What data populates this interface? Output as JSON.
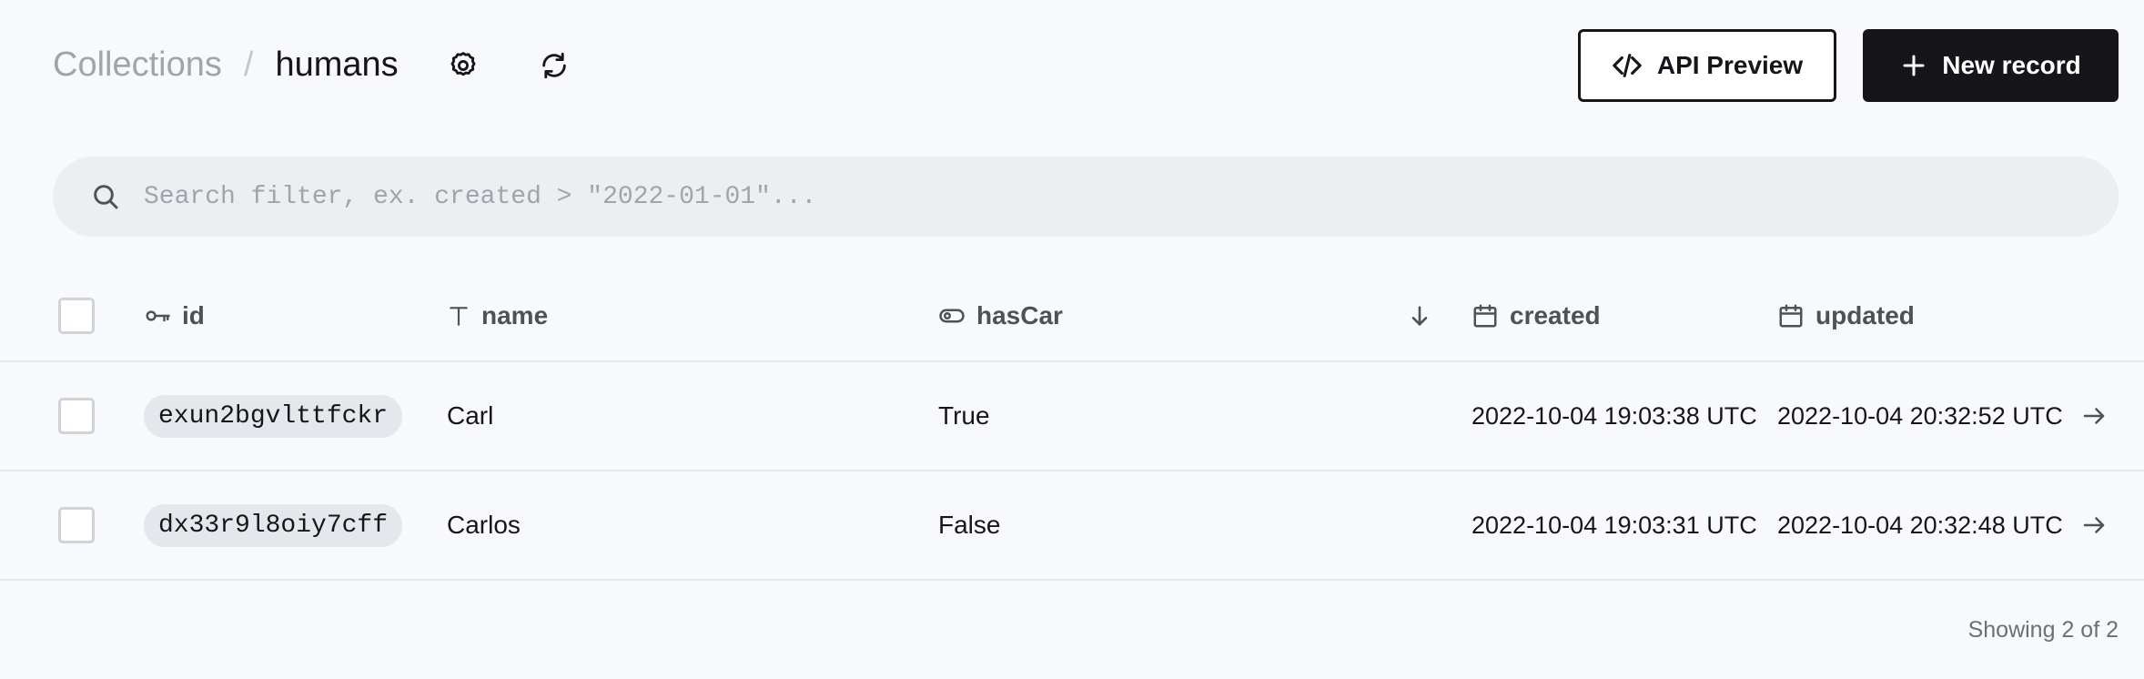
{
  "breadcrumb": {
    "parent": "Collections",
    "separator": "/",
    "current": "humans"
  },
  "toolbar": {
    "api_preview_label": "API Preview",
    "new_record_label": "New record"
  },
  "search": {
    "placeholder": "Search filter, ex. created > \"2022-01-01\"...",
    "value": ""
  },
  "table": {
    "columns": [
      {
        "label": "id",
        "icon": "key-icon"
      },
      {
        "label": "name",
        "icon": "text-icon"
      },
      {
        "label": "hasCar",
        "icon": "toggle-icon"
      },
      {
        "label": "created",
        "icon": "calendar-icon"
      },
      {
        "label": "updated",
        "icon": "calendar-icon"
      }
    ],
    "rows": [
      {
        "id": "exun2bgvlttfckr",
        "name": "Carl",
        "hasCar": "True",
        "created": "2022-10-04 19:03:38 UTC",
        "updated": "2022-10-04 20:32:52 UTC"
      },
      {
        "id": "dx33r9l8oiy7cff",
        "name": "Carlos",
        "hasCar": "False",
        "created": "2022-10-04 19:03:31 UTC",
        "updated": "2022-10-04 20:32:48 UTC"
      }
    ]
  },
  "footer": {
    "showing_text": "Showing 2 of 2"
  },
  "colors": {
    "background": "#f8f9fa",
    "primary": "#16161a",
    "muted": "#a0a4ab",
    "pill": "#e4e8ec",
    "search_bg": "#ebeff2"
  }
}
